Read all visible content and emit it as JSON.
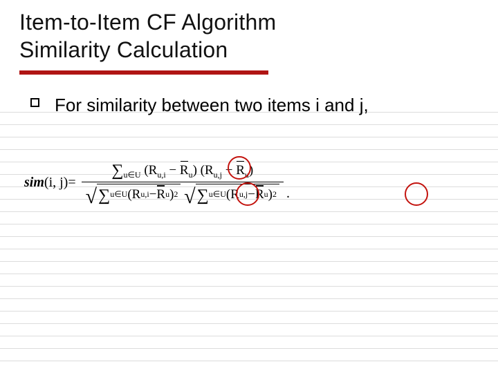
{
  "title": {
    "line1": "Item-to-Item CF Algorithm",
    "line2": "Similarity Calculation"
  },
  "bullet": {
    "text": "For similarity between two items i and j,"
  },
  "equation": {
    "lhs_func": "sim",
    "lhs_args": "(i, j)",
    "equals": " = ",
    "sum_sub": "u∈U",
    "R": "R",
    "Rbar_sub": "u",
    "u_i": "u,i",
    "u_j": "u,j",
    "square": "2",
    "dot": "."
  }
}
